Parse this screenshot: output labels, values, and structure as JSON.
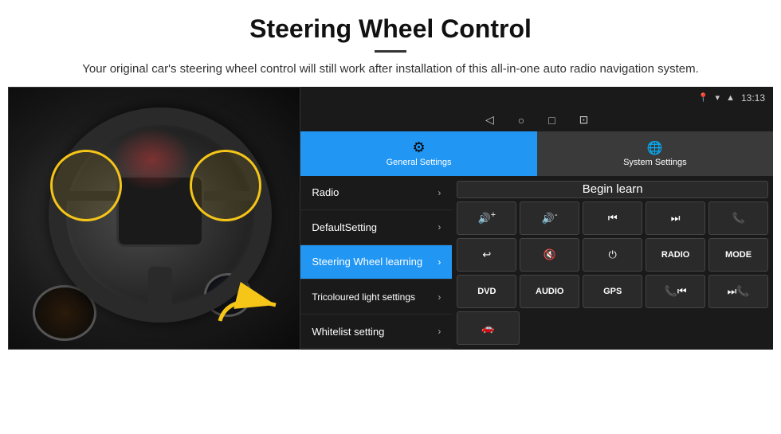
{
  "header": {
    "title": "Steering Wheel Control",
    "subtitle": "Your original car's steering wheel control will still work after installation of this all-in-one auto radio navigation system."
  },
  "status_bar": {
    "time": "13:13",
    "icons": [
      "location",
      "wifi",
      "signal"
    ]
  },
  "nav_bar": {
    "icons": [
      "◁",
      "○",
      "□",
      "⊡"
    ]
  },
  "tabs": [
    {
      "label": "General Settings",
      "icon": "⚙",
      "active": true
    },
    {
      "label": "System Settings",
      "icon": "🌐",
      "active": false
    }
  ],
  "menu_items": [
    {
      "label": "Radio",
      "active": false
    },
    {
      "label": "DefaultSetting",
      "active": false
    },
    {
      "label": "Steering Wheel learning",
      "active": true
    },
    {
      "label": "Tricoloured light settings",
      "active": false
    },
    {
      "label": "Whitelist setting",
      "active": false
    }
  ],
  "right_panel": {
    "begin_learn_label": "Begin learn",
    "control_buttons": [
      {
        "icon": "🔊+",
        "type": "icon"
      },
      {
        "icon": "🔊-",
        "type": "icon"
      },
      {
        "icon": "⏮",
        "type": "icon"
      },
      {
        "icon": "⏭",
        "type": "icon"
      },
      {
        "icon": "📞",
        "type": "icon"
      },
      {
        "icon": "↩",
        "type": "icon"
      },
      {
        "icon": "🔇",
        "type": "icon"
      },
      {
        "icon": "⏻",
        "type": "icon"
      },
      {
        "label": "RADIO",
        "type": "text"
      },
      {
        "label": "MODE",
        "type": "text"
      },
      {
        "label": "DVD",
        "type": "text"
      },
      {
        "label": "AUDIO",
        "type": "text"
      },
      {
        "label": "GPS",
        "type": "text"
      },
      {
        "icon": "📞⏮",
        "type": "icon"
      },
      {
        "icon": "⏭📞",
        "type": "icon"
      }
    ],
    "bottom_buttons": [
      {
        "icon": "🚗",
        "type": "icon"
      }
    ]
  }
}
